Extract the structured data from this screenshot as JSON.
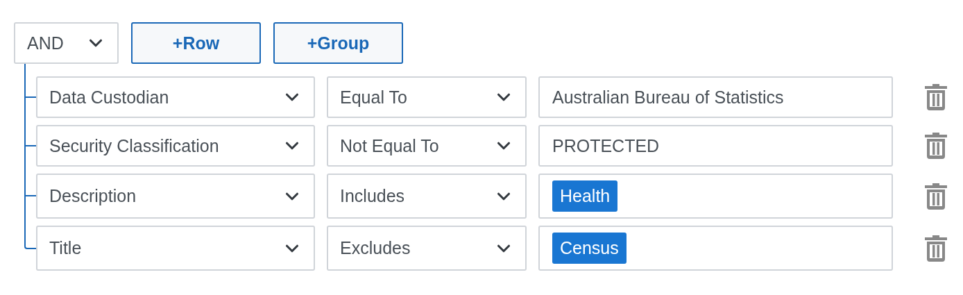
{
  "group": {
    "combinator": "AND",
    "buttons": [
      "+Row",
      "+Group"
    ],
    "rules": [
      {
        "field": "Data Custodian",
        "operator": "Equal To",
        "value": {
          "kind": "text",
          "text": "Australian Bureau of Statistics"
        }
      },
      {
        "field": "Security Classification",
        "operator": "Not Equal To",
        "value": {
          "kind": "text",
          "text": "PROTECTED"
        }
      },
      {
        "field": "Description",
        "operator": "Includes",
        "value": {
          "kind": "tags",
          "tags": [
            "Health"
          ]
        }
      },
      {
        "field": "Title",
        "operator": "Excludes",
        "value": {
          "kind": "tags",
          "tags": [
            "Census"
          ]
        }
      }
    ]
  }
}
